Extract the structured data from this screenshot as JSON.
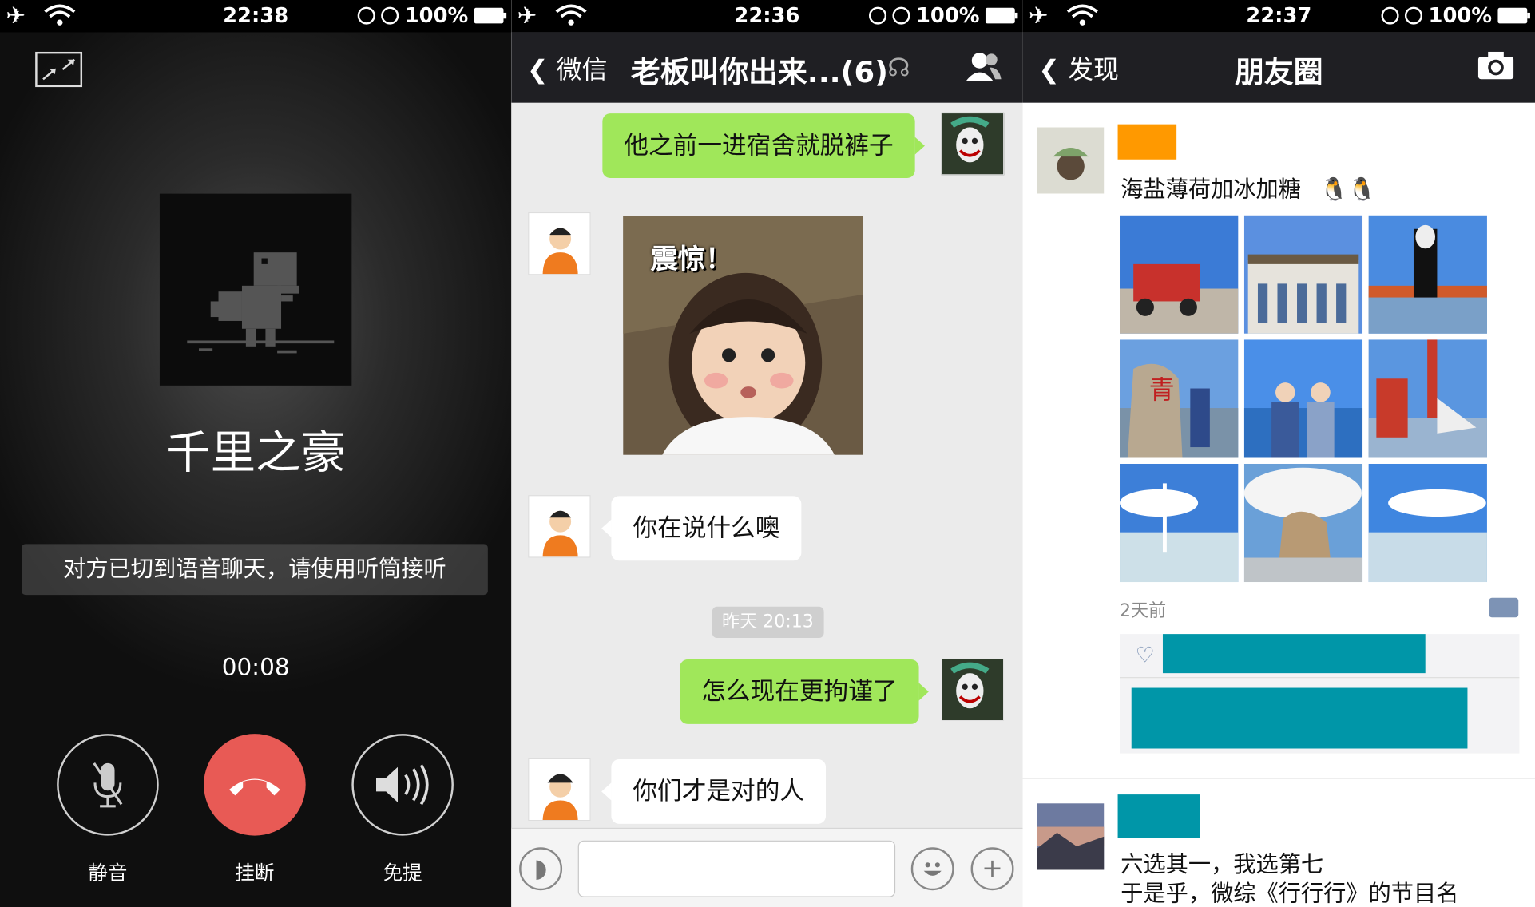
{
  "colors": {
    "chat_green": "#a0e75a",
    "hangup_red": "#e85a55",
    "navbar": "#1f1f23",
    "redact_teal": "#0096a8",
    "redact_orange": "#ff9900"
  },
  "call": {
    "status_time": "22:38",
    "battery": "100%",
    "caller_name": "千里之豪",
    "notice": "对方已切到语音聊天，请使用听筒接听",
    "duration": "00:08",
    "mute_label": "静音",
    "hangup_label": "挂断",
    "speaker_label": "免提",
    "icons": [
      "minimize-icon",
      "mic-off-icon",
      "hangup-icon",
      "speaker-icon",
      "dino-avatar"
    ]
  },
  "chat": {
    "status_time": "22:36",
    "battery": "100%",
    "back_label": "微信",
    "title": "老板叫你出来...(6)",
    "messages": [
      {
        "side": "right",
        "text": "他之前一进宿舍就脱裤子"
      },
      {
        "side": "left",
        "type": "image",
        "text": "震惊！"
      },
      {
        "side": "left",
        "text": "你在说什么噢"
      },
      {
        "side": "right",
        "text": "怎么现在更拘谨了"
      },
      {
        "side": "left",
        "text": "你们才是对的人"
      }
    ],
    "timestamp": "昨天 20:13"
  },
  "moments": {
    "status_time": "22:37",
    "battery": "100%",
    "back_label": "发现",
    "title": "朋友圈",
    "post1": {
      "text": "海盐薄荷加冰加糖",
      "time": "2天前"
    },
    "post2": {
      "line1": "六选其一，我选第七",
      "line2": "于是乎，微综《行行行》的节目名"
    }
  }
}
